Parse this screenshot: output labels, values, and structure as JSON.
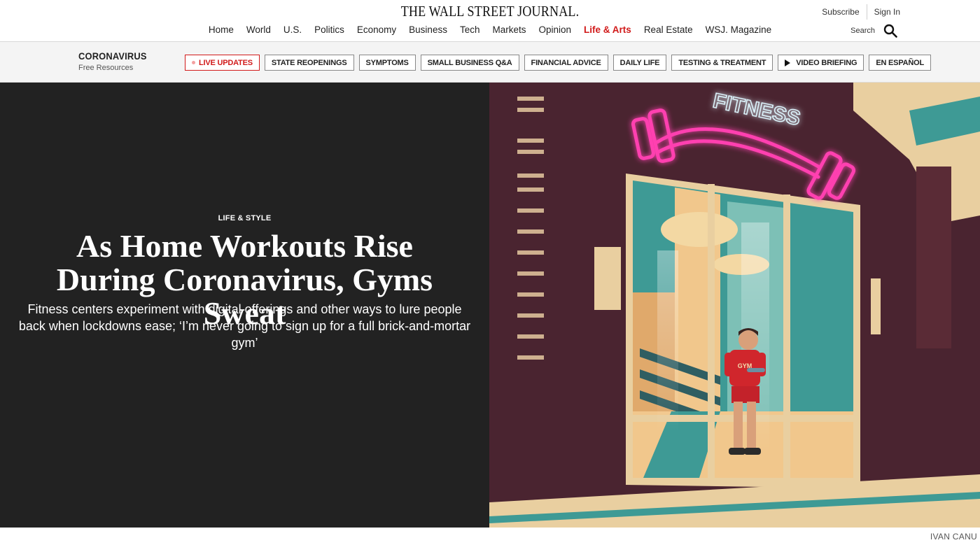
{
  "masthead": {
    "logo": "THE WALL STREET JOURNAL.",
    "subscribe": "Subscribe",
    "signin": "Sign In",
    "search_label": "Search",
    "nav": [
      "Home",
      "World",
      "U.S.",
      "Politics",
      "Economy",
      "Business",
      "Tech",
      "Markets",
      "Opinion",
      "Life & Arts",
      "Real Estate",
      "WSJ. Magazine"
    ],
    "active_nav": "Life & Arts"
  },
  "coronavirus_bar": {
    "title": "CORONAVIRUS",
    "subtitle": "Free Resources",
    "pills": [
      {
        "label": "LIVE UPDATES"
      },
      {
        "label": "STATE REOPENINGS"
      },
      {
        "label": "SYMPTOMS"
      },
      {
        "label": "SMALL BUSINESS Q&A"
      },
      {
        "label": "FINANCIAL ADVICE"
      },
      {
        "label": "DAILY LIFE"
      },
      {
        "label": "TESTING & TREATMENT"
      },
      {
        "label": "VIDEO BRIEFING"
      },
      {
        "label": "EN ESPAÑOL"
      }
    ]
  },
  "hero": {
    "kicker": "LIFE & STYLE",
    "headline": "As Home Workouts Rise During Coronavirus, Gyms Sweat",
    "dek": "Fitness centers experiment with digital offerings and other ways to lure people back when lockdowns ease; ‘I’m never going to sign up for a full brick-and-mortar gym’",
    "image": {
      "neon_sign": "FITNESS",
      "shirt_text": "GYM"
    },
    "credit": "IVAN CANU"
  },
  "colors": {
    "accent_red": "#d11a1a",
    "hero_left_bg": "#222222",
    "building": "#4a2430",
    "neon_pink": "#ff3fb0",
    "teal": "#3e9a95",
    "cream": "#f3dcae"
  }
}
